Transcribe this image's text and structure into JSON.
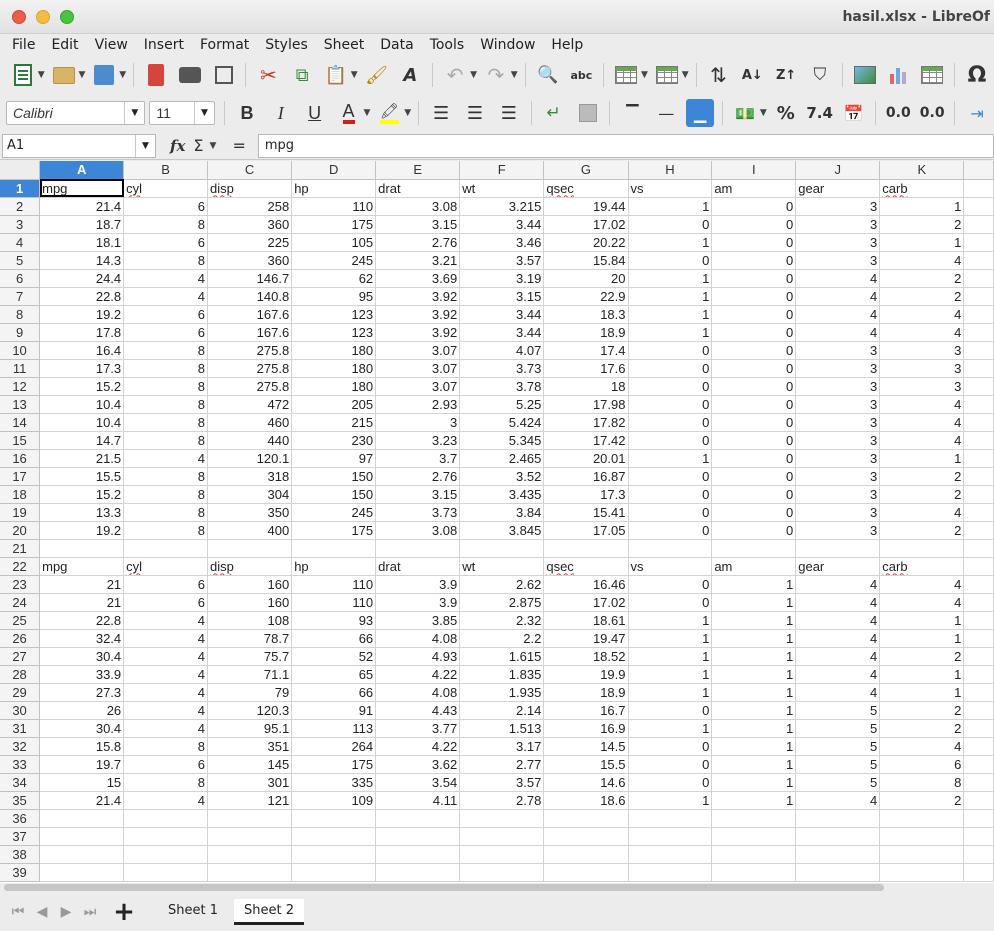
{
  "window": {
    "title": "hasil.xlsx - LibreOf"
  },
  "menu": [
    "File",
    "Edit",
    "View",
    "Insert",
    "Format",
    "Styles",
    "Sheet",
    "Data",
    "Tools",
    "Window",
    "Help"
  ],
  "toolbar2": {
    "font_name": "Calibri",
    "font_size": "11",
    "percent": "%",
    "number_format": "7.4",
    "decimal_add": "0.0",
    "decimal_remove": "0.0"
  },
  "formula": {
    "cell_ref": "A1",
    "fx": "fx",
    "sigma": "Σ",
    "equals": "=",
    "content": "mpg"
  },
  "sheet": {
    "columns": [
      "A",
      "B",
      "C",
      "D",
      "E",
      "F",
      "G",
      "H",
      "I",
      "J",
      "K"
    ],
    "headers": [
      "mpg",
      "cyl",
      "disp",
      "hp",
      "drat",
      "wt",
      "qsec",
      "vs",
      "am",
      "gear",
      "carb"
    ],
    "squiggle_headers": [
      "cyl",
      "disp",
      "qsec",
      "carb"
    ],
    "block1": [
      [
        "21.4",
        "6",
        "258",
        "110",
        "3.08",
        "3.215",
        "19.44",
        "1",
        "0",
        "3",
        "1"
      ],
      [
        "18.7",
        "8",
        "360",
        "175",
        "3.15",
        "3.44",
        "17.02",
        "0",
        "0",
        "3",
        "2"
      ],
      [
        "18.1",
        "6",
        "225",
        "105",
        "2.76",
        "3.46",
        "20.22",
        "1",
        "0",
        "3",
        "1"
      ],
      [
        "14.3",
        "8",
        "360",
        "245",
        "3.21",
        "3.57",
        "15.84",
        "0",
        "0",
        "3",
        "4"
      ],
      [
        "24.4",
        "4",
        "146.7",
        "62",
        "3.69",
        "3.19",
        "20",
        "1",
        "0",
        "4",
        "2"
      ],
      [
        "22.8",
        "4",
        "140.8",
        "95",
        "3.92",
        "3.15",
        "22.9",
        "1",
        "0",
        "4",
        "2"
      ],
      [
        "19.2",
        "6",
        "167.6",
        "123",
        "3.92",
        "3.44",
        "18.3",
        "1",
        "0",
        "4",
        "4"
      ],
      [
        "17.8",
        "6",
        "167.6",
        "123",
        "3.92",
        "3.44",
        "18.9",
        "1",
        "0",
        "4",
        "4"
      ],
      [
        "16.4",
        "8",
        "275.8",
        "180",
        "3.07",
        "4.07",
        "17.4",
        "0",
        "0",
        "3",
        "3"
      ],
      [
        "17.3",
        "8",
        "275.8",
        "180",
        "3.07",
        "3.73",
        "17.6",
        "0",
        "0",
        "3",
        "3"
      ],
      [
        "15.2",
        "8",
        "275.8",
        "180",
        "3.07",
        "3.78",
        "18",
        "0",
        "0",
        "3",
        "3"
      ],
      [
        "10.4",
        "8",
        "472",
        "205",
        "2.93",
        "5.25",
        "17.98",
        "0",
        "0",
        "3",
        "4"
      ],
      [
        "10.4",
        "8",
        "460",
        "215",
        "3",
        "5.424",
        "17.82",
        "0",
        "0",
        "3",
        "4"
      ],
      [
        "14.7",
        "8",
        "440",
        "230",
        "3.23",
        "5.345",
        "17.42",
        "0",
        "0",
        "3",
        "4"
      ],
      [
        "21.5",
        "4",
        "120.1",
        "97",
        "3.7",
        "2.465",
        "20.01",
        "1",
        "0",
        "3",
        "1"
      ],
      [
        "15.5",
        "8",
        "318",
        "150",
        "2.76",
        "3.52",
        "16.87",
        "0",
        "0",
        "3",
        "2"
      ],
      [
        "15.2",
        "8",
        "304",
        "150",
        "3.15",
        "3.435",
        "17.3",
        "0",
        "0",
        "3",
        "2"
      ],
      [
        "13.3",
        "8",
        "350",
        "245",
        "3.73",
        "3.84",
        "15.41",
        "0",
        "0",
        "3",
        "4"
      ],
      [
        "19.2",
        "8",
        "400",
        "175",
        "3.08",
        "3.845",
        "17.05",
        "0",
        "0",
        "3",
        "2"
      ]
    ],
    "block2": [
      [
        "21",
        "6",
        "160",
        "110",
        "3.9",
        "2.62",
        "16.46",
        "0",
        "1",
        "4",
        "4"
      ],
      [
        "21",
        "6",
        "160",
        "110",
        "3.9",
        "2.875",
        "17.02",
        "0",
        "1",
        "4",
        "4"
      ],
      [
        "22.8",
        "4",
        "108",
        "93",
        "3.85",
        "2.32",
        "18.61",
        "1",
        "1",
        "4",
        "1"
      ],
      [
        "32.4",
        "4",
        "78.7",
        "66",
        "4.08",
        "2.2",
        "19.47",
        "1",
        "1",
        "4",
        "1"
      ],
      [
        "30.4",
        "4",
        "75.7",
        "52",
        "4.93",
        "1.615",
        "18.52",
        "1",
        "1",
        "4",
        "2"
      ],
      [
        "33.9",
        "4",
        "71.1",
        "65",
        "4.22",
        "1.835",
        "19.9",
        "1",
        "1",
        "4",
        "1"
      ],
      [
        "27.3",
        "4",
        "79",
        "66",
        "4.08",
        "1.935",
        "18.9",
        "1",
        "1",
        "4",
        "1"
      ],
      [
        "26",
        "4",
        "120.3",
        "91",
        "4.43",
        "2.14",
        "16.7",
        "0",
        "1",
        "5",
        "2"
      ],
      [
        "30.4",
        "4",
        "95.1",
        "113",
        "3.77",
        "1.513",
        "16.9",
        "1",
        "1",
        "5",
        "2"
      ],
      [
        "15.8",
        "8",
        "351",
        "264",
        "4.22",
        "3.17",
        "14.5",
        "0",
        "1",
        "5",
        "4"
      ],
      [
        "19.7",
        "6",
        "145",
        "175",
        "3.62",
        "2.77",
        "15.5",
        "0",
        "1",
        "5",
        "6"
      ],
      [
        "15",
        "8",
        "301",
        "335",
        "3.54",
        "3.57",
        "14.6",
        "0",
        "1",
        "5",
        "8"
      ],
      [
        "21.4",
        "4",
        "121",
        "109",
        "4.11",
        "2.78",
        "18.6",
        "1",
        "1",
        "4",
        "2"
      ]
    ],
    "total_rows": 39
  },
  "tabs": [
    {
      "label": "Sheet 1",
      "active": false
    },
    {
      "label": "Sheet 2",
      "active": true
    }
  ]
}
